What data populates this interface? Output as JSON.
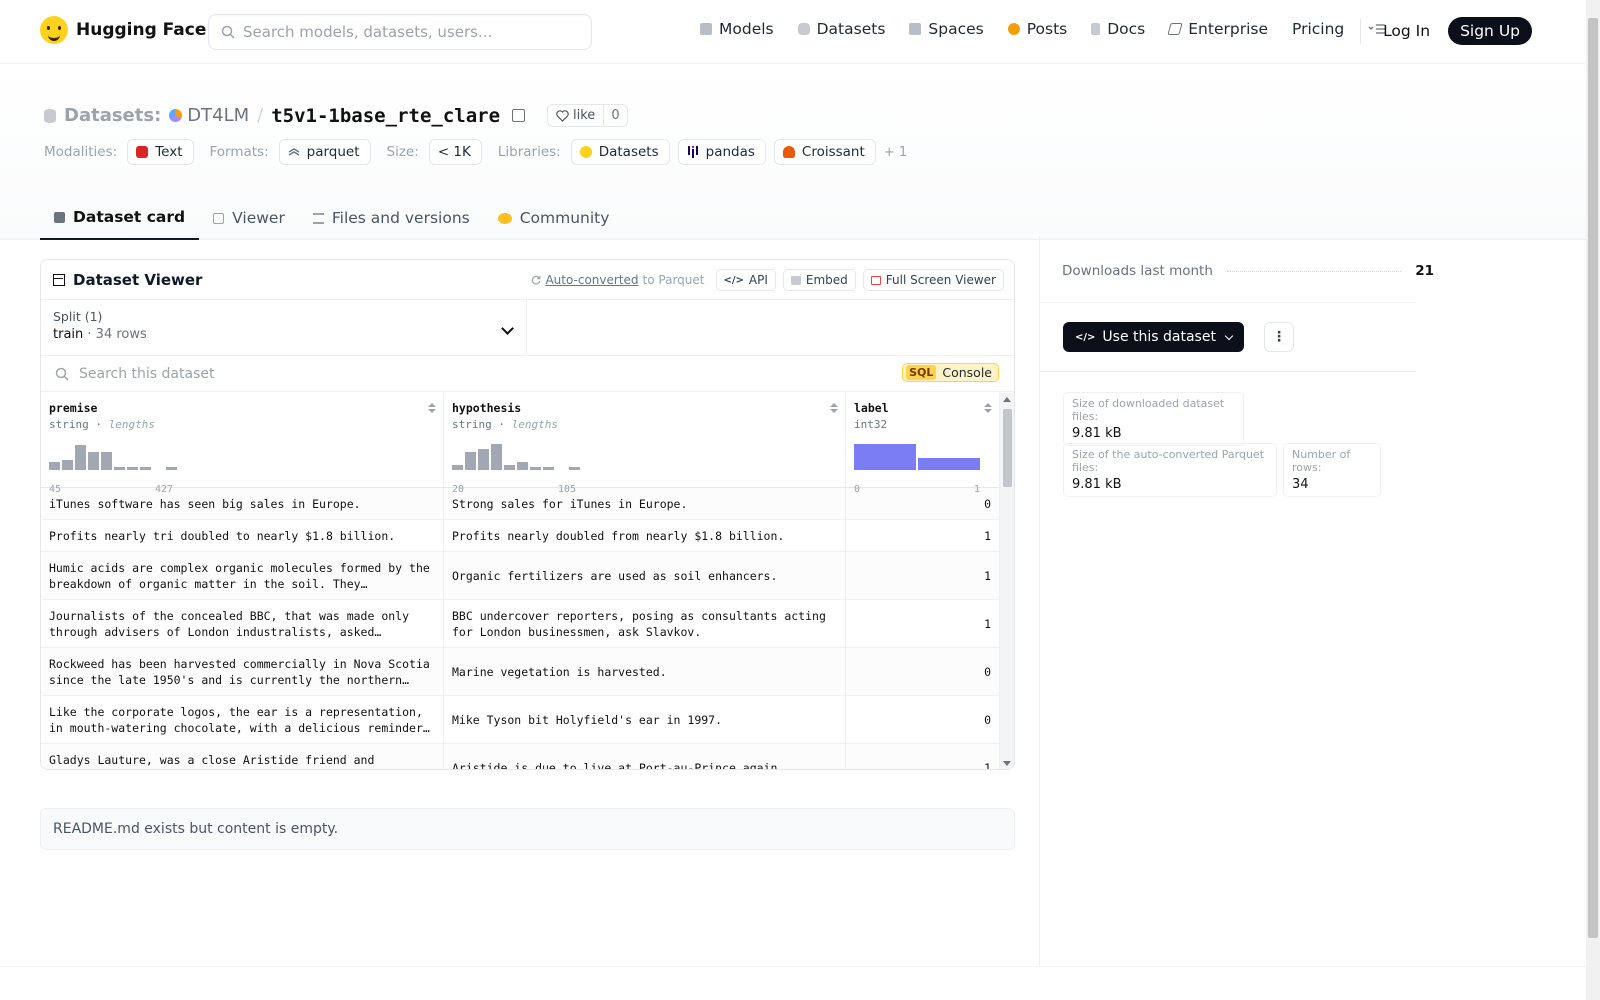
{
  "header": {
    "logo_text": "Hugging Face",
    "search_placeholder": "Search models, datasets, users...",
    "nav": [
      {
        "label": "Models",
        "icon": "cube-icon",
        "color": "#9ca3af"
      },
      {
        "label": "Datasets",
        "icon": "database-icon",
        "color": "#9ca3af"
      },
      {
        "label": "Spaces",
        "icon": "grid-icon",
        "color": "#9ca3af"
      },
      {
        "label": "Posts",
        "icon": "posts-icon",
        "color": "#f59e0b"
      },
      {
        "label": "Docs",
        "icon": "docs-icon",
        "color": "#9ca3af"
      },
      {
        "label": "Enterprise",
        "icon": "enterprise-icon",
        "color": "#6b7280"
      },
      {
        "label": "Pricing",
        "icon": "",
        "color": ""
      }
    ],
    "login": "Log In",
    "signup": "Sign Up"
  },
  "dataset": {
    "kind": "Datasets:",
    "org": "DT4LM",
    "slash": "/",
    "name": "t5v1-1base_rte_clare",
    "like_label": "like",
    "like_count": "0"
  },
  "tags": {
    "modalities_label": "Modalities:",
    "modalities": [
      {
        "label": "Text",
        "color": "#dc2626"
      }
    ],
    "formats_label": "Formats:",
    "formats": [
      {
        "label": "parquet",
        "color": "#6b7280"
      }
    ],
    "size_label": "Size:",
    "size": "< 1K",
    "libraries_label": "Libraries:",
    "libraries": [
      {
        "label": "Datasets",
        "color": "#ffd21e"
      },
      {
        "label": "pandas",
        "color": "#150458"
      },
      {
        "label": "Croissant",
        "color": "#ea580c"
      }
    ],
    "more": "+ 1"
  },
  "tabs": [
    {
      "label": "Dataset card",
      "active": true,
      "color": "#6b7280"
    },
    {
      "label": "Viewer",
      "active": false,
      "color": "#9ca3af"
    },
    {
      "label": "Files and versions",
      "active": false,
      "color": "#9ca3af"
    },
    {
      "label": "Community",
      "active": false,
      "color": "#f59e0b"
    }
  ],
  "viewer": {
    "title": "Dataset Viewer",
    "auto_converted": "Auto-converted",
    "to_parquet": "to Parquet",
    "api": "API",
    "embed": "Embed",
    "full_screen": "Full Screen Viewer",
    "split_label": "Split (1)",
    "split_value": "train",
    "split_rows": "34 rows",
    "search_placeholder": "Search this dataset",
    "sql_badge": "SQL",
    "sql_label": "Console",
    "columns": [
      {
        "name": "premise",
        "type": "string",
        "hint": "lengths",
        "min": "45",
        "max": "427",
        "bins": [
          0.3,
          0.4,
          0.95,
          0.7,
          0.7,
          0.12,
          0.12,
          0.12,
          0,
          0.12
        ]
      },
      {
        "name": "hypothesis",
        "type": "string",
        "hint": "lengths",
        "min": "20",
        "max": "105",
        "bins": [
          0.2,
          0.7,
          0.8,
          1.0,
          0.2,
          0.3,
          0.1,
          0.1,
          0,
          0.1
        ]
      },
      {
        "name": "label",
        "type": "int32",
        "hint": "",
        "min": "0",
        "max": "1",
        "bins": [
          1.0,
          0.45
        ]
      }
    ],
    "rows": [
      {
        "premise": "iTunes software has seen big sales in Europe.",
        "hypothesis": "Strong sales for iTunes in Europe.",
        "label": "0"
      },
      {
        "premise": "Profits nearly tri doubled to nearly $1.8 billion.",
        "hypothesis": "Profits nearly doubled from nearly $1.8 billion.",
        "label": "1"
      },
      {
        "premise": "Humic acids are complex organic molecules formed by the breakdown of organic matter in the soil. They primarily…",
        "hypothesis": "Organic fertilizers are used as soil enhancers.",
        "label": "1"
      },
      {
        "premise": "Journalists of the concealed BBC, that was made only through advisers of London industralists, asked Slavkov.",
        "hypothesis": "BBC undercover reporters, posing as consultants acting for London businessmen, ask Slavkov.",
        "label": "1"
      },
      {
        "premise": "Rockweed has been harvested commercially in Nova Scotia since the late 1950's and is currently the northern mos…",
        "hypothesis": "Marine vegetation is harvested.",
        "label": "0"
      },
      {
        "premise": "Like the corporate logos, the ear is a representation, in mouth-watering chocolate, with a delicious reminder…",
        "hypothesis": "Mike Tyson bit Holyfield's ear in 1997.",
        "label": "0"
      },
      {
        "premise": "Gladys Lauture, was a close Aristide friend and longtime",
        "hypothesis": "Aristide is due to live at Port-au-Prince again.",
        "label": "1"
      }
    ]
  },
  "readme": "README.md exists but content is empty.",
  "sidebar": {
    "downloads_label": "Downloads last month",
    "downloads_value": "21",
    "use_button": "Use this dataset",
    "stats": [
      {
        "label": "Size of downloaded dataset files:",
        "value": "9.81 kB"
      },
      {
        "label": "Size of the auto-converted Parquet files:",
        "value": "9.81 kB"
      },
      {
        "label": "Number of rows:",
        "value": "34"
      }
    ]
  }
}
